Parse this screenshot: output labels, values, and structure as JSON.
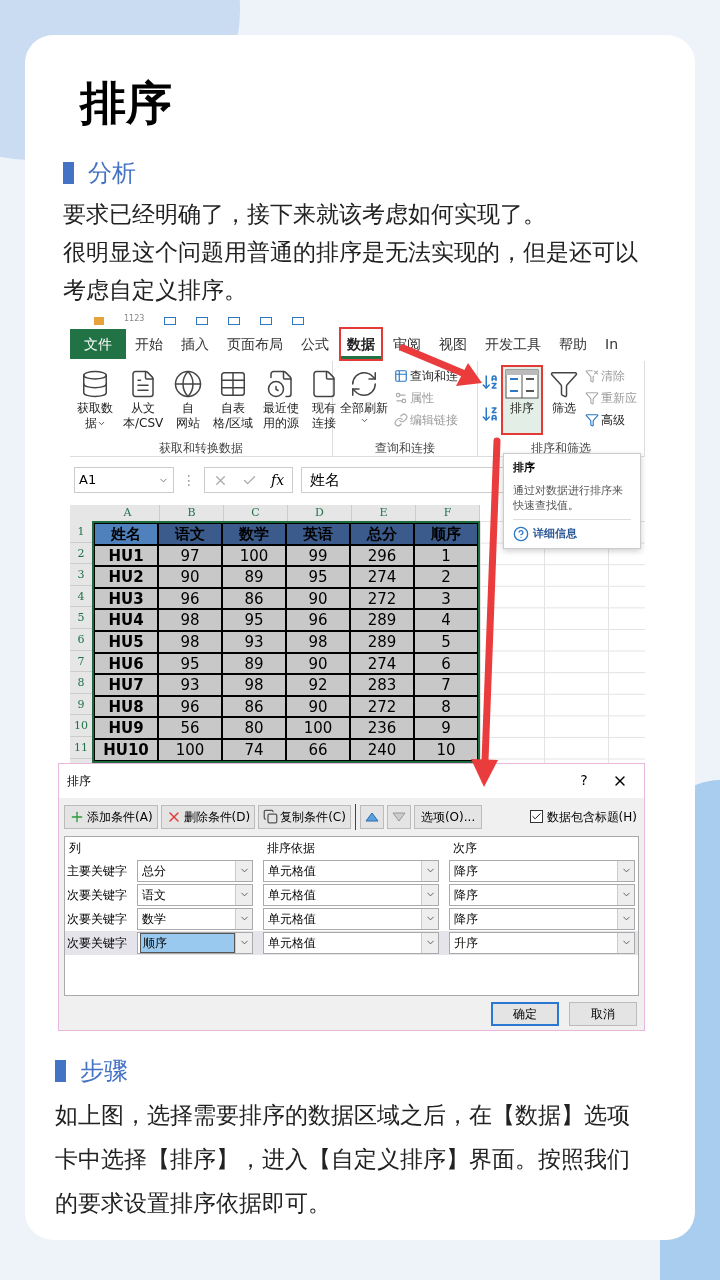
{
  "title": "排序",
  "analysis": {
    "heading": "分析",
    "paragraphs": [
      "要求已经明确了，接下来就该考虑如何实现了。",
      "很明显这个问题用普通的排序是无法实现的，但是还可以考虑自定义排序。"
    ]
  },
  "excel": {
    "qat_label": "1123",
    "tabs": [
      {
        "label": "文件",
        "kind": "file",
        "selected": false,
        "highlighted": false
      },
      {
        "label": "开始",
        "kind": "tab",
        "selected": false,
        "highlighted": false
      },
      {
        "label": "插入",
        "kind": "tab",
        "selected": false,
        "highlighted": false
      },
      {
        "label": "页面布局",
        "kind": "tab",
        "selected": false,
        "highlighted": false
      },
      {
        "label": "公式",
        "kind": "tab",
        "selected": false,
        "highlighted": false
      },
      {
        "label": "数据",
        "kind": "tab",
        "selected": true,
        "highlighted": true
      },
      {
        "label": "审阅",
        "kind": "tab",
        "selected": false,
        "highlighted": false
      },
      {
        "label": "视图",
        "kind": "tab",
        "selected": false,
        "highlighted": false
      },
      {
        "label": "开发工具",
        "kind": "tab",
        "selected": false,
        "highlighted": false
      },
      {
        "label": "帮助",
        "kind": "tab",
        "selected": false,
        "highlighted": false
      },
      {
        "label": "In",
        "kind": "tab",
        "selected": false,
        "highlighted": false
      }
    ],
    "groups": [
      {
        "label": "获取和转换数据",
        "items": [
          {
            "kind": "large_menu",
            "lines": [
              "获取数",
              "据"
            ],
            "highlighted": false
          },
          {
            "kind": "large",
            "lines": [
              "从文",
              "本/CSV"
            ],
            "highlighted": false
          },
          {
            "kind": "large",
            "lines": [
              "自",
              "网站"
            ],
            "highlighted": false
          },
          {
            "kind": "large",
            "lines": [
              "自表",
              "格/区域"
            ],
            "highlighted": false
          },
          {
            "kind": "large",
            "lines": [
              "最近使",
              "用的源"
            ],
            "highlighted": false
          },
          {
            "kind": "large",
            "lines": [
              "现有",
              "连接"
            ],
            "highlighted": false
          }
        ]
      },
      {
        "label": "查询和连接",
        "items": [
          {
            "kind": "large_menu",
            "lines": [
              "全部刷新"
            ],
            "highlighted": false
          },
          {
            "kind": "small",
            "lines": [
              "查询和连"
            ],
            "disabled": false
          },
          {
            "kind": "small",
            "lines": [
              "属性"
            ],
            "disabled": true
          },
          {
            "kind": "small",
            "lines": [
              "编辑链接"
            ],
            "disabled": true
          }
        ]
      },
      {
        "label": "排序和筛选",
        "items": [
          {
            "kind": "sort_pair"
          },
          {
            "kind": "large",
            "lines": [
              "排序"
            ],
            "highlighted": true
          },
          {
            "kind": "large",
            "lines": [
              "筛选"
            ],
            "highlighted": false
          },
          {
            "kind": "small",
            "lines": [
              "清除"
            ],
            "disabled": true
          },
          {
            "kind": "small",
            "lines": [
              "重新应"
            ],
            "disabled": true
          },
          {
            "kind": "small",
            "lines": [
              "高级"
            ],
            "disabled": false
          }
        ]
      }
    ],
    "name_box": "A1",
    "formula_separator": "⋮",
    "function_label": "fx",
    "formula": "姓名",
    "tooltip": {
      "title": "排序",
      "text": "通过对数据进行排序来快速查找值。",
      "link": "详细信息"
    },
    "columns": [
      "A",
      "B",
      "C",
      "D",
      "E",
      "F"
    ],
    "header": [
      "姓名",
      "语文",
      "数学",
      "英语",
      "总分",
      "顺序"
    ],
    "rows": [
      {
        "number": "1"
      },
      {
        "number": "2",
        "cells": [
          "HU1",
          "97",
          "100",
          "99",
          "296",
          "1"
        ]
      },
      {
        "number": "3",
        "cells": [
          "HU2",
          "90",
          "89",
          "95",
          "274",
          "2"
        ]
      },
      {
        "number": "4",
        "cells": [
          "HU3",
          "96",
          "86",
          "90",
          "272",
          "3"
        ]
      },
      {
        "number": "5",
        "cells": [
          "HU4",
          "98",
          "95",
          "96",
          "289",
          "4"
        ]
      },
      {
        "number": "6",
        "cells": [
          "HU5",
          "98",
          "93",
          "98",
          "289",
          "5"
        ]
      },
      {
        "number": "7",
        "cells": [
          "HU6",
          "95",
          "89",
          "90",
          "274",
          "6"
        ]
      },
      {
        "number": "8",
        "cells": [
          "HU7",
          "93",
          "98",
          "92",
          "283",
          "7"
        ]
      },
      {
        "number": "9",
        "cells": [
          "HU8",
          "96",
          "86",
          "90",
          "272",
          "8"
        ]
      },
      {
        "number": "10",
        "cells": [
          "HU9",
          "56",
          "80",
          "100",
          "236",
          "9"
        ]
      },
      {
        "number": "11",
        "cells": [
          "HU10",
          "100",
          "74",
          "66",
          "240",
          "10"
        ]
      }
    ]
  },
  "sort_dialog": {
    "title": "排序",
    "help": "?",
    "toolbar": [
      {
        "label": "添加条件(A)",
        "kind": "add"
      },
      {
        "label": "删除条件(D)",
        "kind": "delete"
      },
      {
        "label": "复制条件(C)",
        "kind": "copy"
      }
    ],
    "move_up": {
      "disabled": false
    },
    "move_down": {
      "disabled": true
    },
    "options": "选项(O)...",
    "has_headers": {
      "label": "数据包含标题(H)",
      "checked": true
    },
    "columns": [
      "列",
      "排序依据",
      "次序"
    ],
    "levels": [
      {
        "label": "主要关键字",
        "column": "总分",
        "basis": "单元格值",
        "order": "降序",
        "selected": false
      },
      {
        "label": "次要关键字",
        "column": "语文",
        "basis": "单元格值",
        "order": "降序",
        "selected": false
      },
      {
        "label": "次要关键字",
        "column": "数学",
        "basis": "单元格值",
        "order": "降序",
        "selected": false
      },
      {
        "label": "次要关键字",
        "column": "顺序",
        "basis": "单元格值",
        "order": "升序",
        "selected": true
      }
    ],
    "buttons": [
      {
        "label": "确定",
        "default": true
      },
      {
        "label": "取消",
        "default": false
      }
    ]
  },
  "steps": {
    "heading": "步骤",
    "paragraphs": [
      "如上图，选择需要排序的数据区域之后，在【数据】选项卡中选择【排序】，进入【自定义排序】界面。按照我们的要求设置排序依据即可。"
    ]
  }
}
